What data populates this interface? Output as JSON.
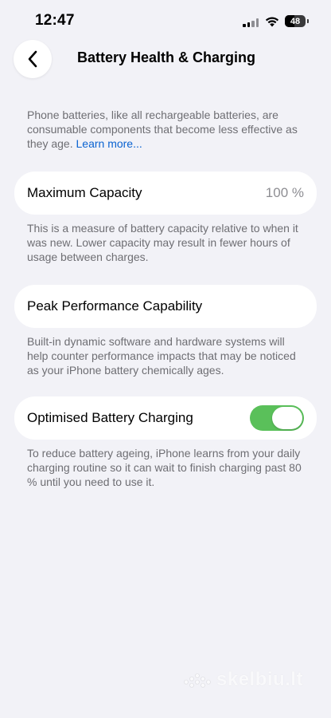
{
  "status_bar": {
    "time": "12:47",
    "battery_percent": "48",
    "signal_bars_active": 2,
    "signal_bars_total": 4
  },
  "nav": {
    "back_icon": "chevron-left-icon",
    "title": "Battery Health & Charging"
  },
  "intro": {
    "text": "Phone batteries, like all rechargeable batteries, are consumable components that become less effective as they age. ",
    "link": "Learn more..."
  },
  "maximum_capacity": {
    "label": "Maximum Capacity",
    "value": "100 %",
    "description": "This is a measure of battery capacity relative to when it was new. Lower capacity may result in fewer hours of usage between charges."
  },
  "peak_performance": {
    "label": "Peak Performance Capability",
    "description": "Built-in dynamic software and hardware systems will help counter performance impacts that may be noticed as your iPhone battery chemically ages."
  },
  "optimised_charging": {
    "label": "Optimised Battery Charging",
    "enabled": true,
    "description": "To reduce battery ageing, iPhone learns from your daily charging routine so it can wait to finish charging past 80 % until you need to use it."
  },
  "watermark": {
    "text": "skelbiu.lt"
  },
  "colors": {
    "background": "#f2f2f7",
    "card": "#ffffff",
    "toggle_on": "#5ac05a",
    "link": "#0a63d1",
    "secondary_text": "#6e6e73"
  }
}
